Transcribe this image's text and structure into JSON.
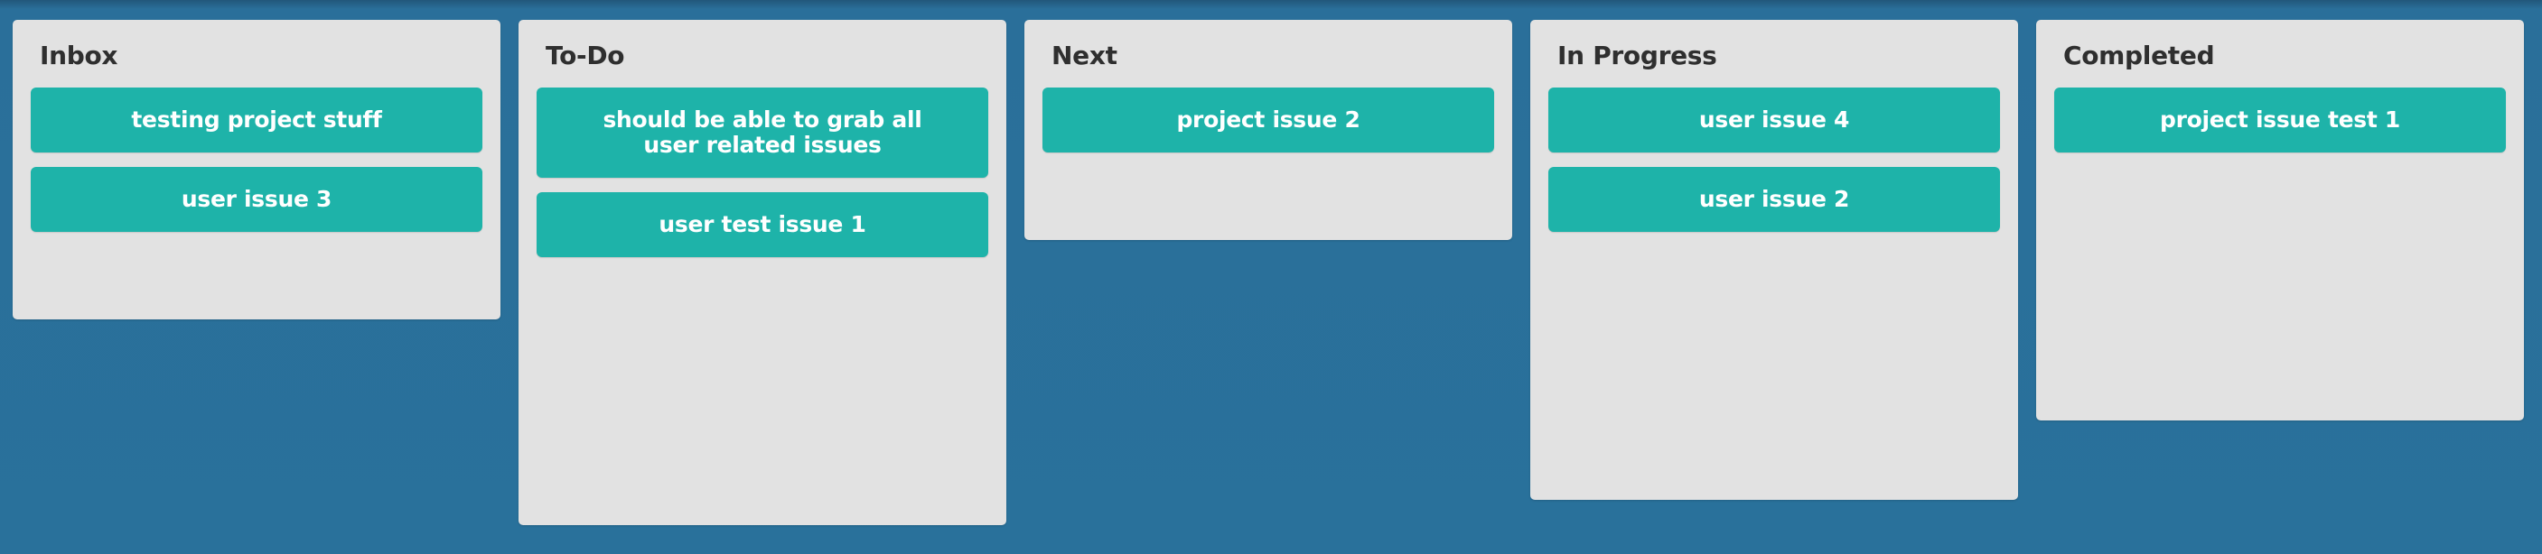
{
  "board": {
    "columns": [
      {
        "title": "Inbox",
        "cards": [
          "testing project stuff",
          "user issue 3"
        ]
      },
      {
        "title": "To-Do",
        "cards": [
          "should be able to grab all user related issues",
          "user test issue 1"
        ]
      },
      {
        "title": "Next",
        "cards": [
          "project issue 2"
        ]
      },
      {
        "title": "In Progress",
        "cards": [
          "user issue 4",
          "user issue 2"
        ]
      },
      {
        "title": "Completed",
        "cards": [
          "project issue test 1"
        ]
      }
    ]
  },
  "colors": {
    "background": "#29719b",
    "column": "#e2e2e2",
    "card": "#1eb3a9",
    "card_text": "#ffffff",
    "title_text": "#2f2f2f"
  }
}
